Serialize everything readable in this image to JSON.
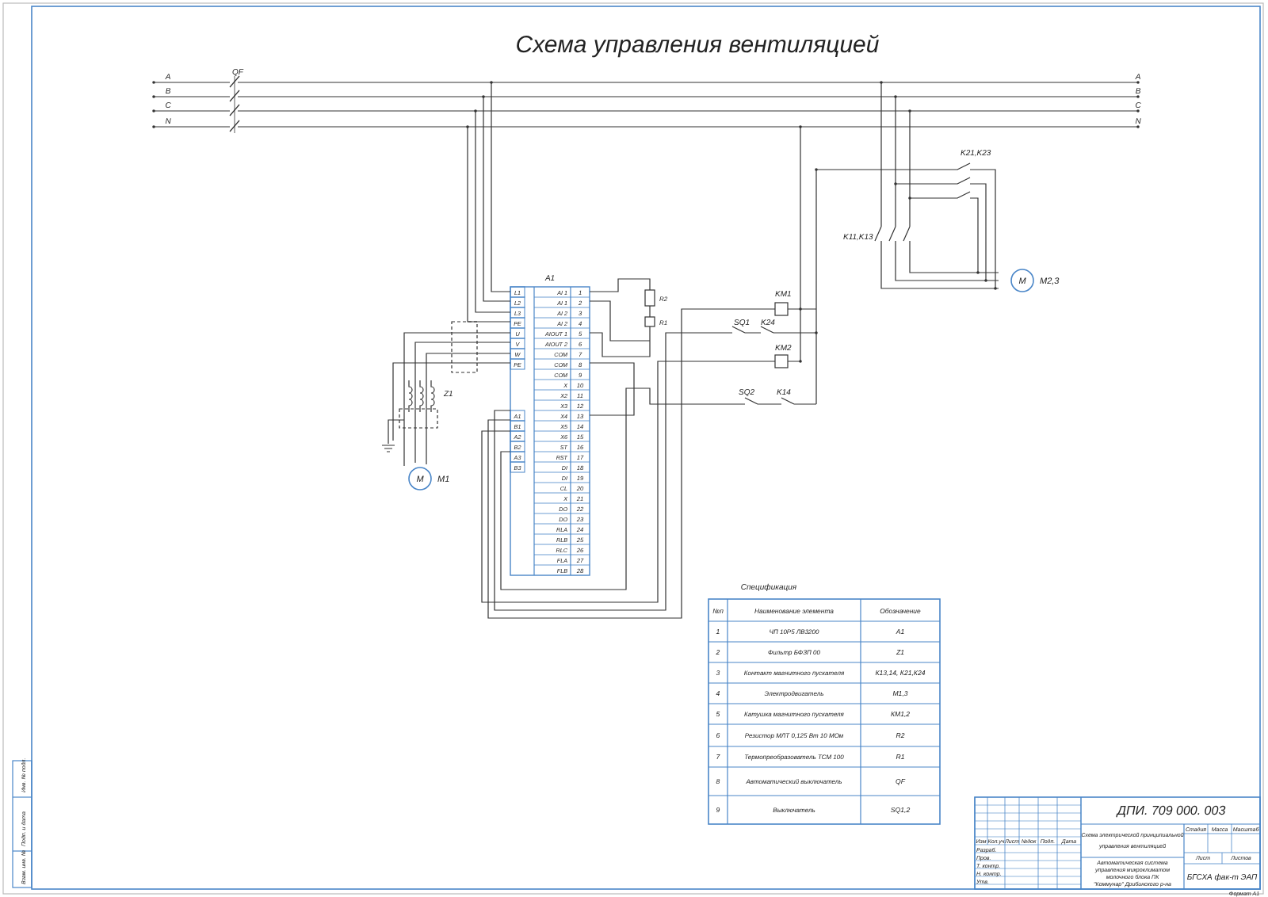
{
  "title": "Схема управления вентиляцией",
  "phase_labels_left": [
    "A",
    "B",
    "C",
    "N"
  ],
  "phase_labels_right": [
    "A",
    "B",
    "C",
    "N"
  ],
  "breaker": {
    "label": "QF"
  },
  "controller": {
    "label": "A1",
    "left_terminals": [
      "L1",
      "L2",
      "L3",
      "PE",
      "U",
      "V",
      "W",
      "PE",
      "A1",
      "B1",
      "A2",
      "B2",
      "A3",
      "B3"
    ],
    "signals": [
      "AI 1",
      "AI 1",
      "AI 2",
      "AI 2",
      "AIOUT 1",
      "AIOUT 2",
      "COM",
      "COM",
      "COM",
      "X",
      "X2",
      "X3",
      "X4",
      "X5",
      "X6",
      "ST",
      "RST",
      "DI",
      "DI",
      "CL",
      "X",
      "DO",
      "DO",
      "RLA",
      "RLB",
      "RLC",
      "FLA",
      "FLB"
    ],
    "numbers": [
      "1",
      "2",
      "3",
      "4",
      "5",
      "6",
      "7",
      "8",
      "9",
      "10",
      "11",
      "12",
      "13",
      "14",
      "15",
      "16",
      "17",
      "18",
      "19",
      "20",
      "21",
      "22",
      "23",
      "24",
      "25",
      "26",
      "27",
      "28"
    ]
  },
  "filter": {
    "label": "Z1"
  },
  "motors": [
    {
      "letter": "M",
      "label": "M1"
    },
    {
      "letter": "M",
      "label": "M2,3"
    }
  ],
  "resistors": [
    {
      "label": "R2"
    },
    {
      "label": "R1"
    }
  ],
  "coils": [
    {
      "label": "KM1"
    },
    {
      "label": "KM2"
    }
  ],
  "contacts": [
    {
      "label": "K21,K23"
    },
    {
      "label": "K11,K13"
    },
    {
      "label": "SQ1"
    },
    {
      "label": "K24"
    },
    {
      "label": "SQ2"
    },
    {
      "label": "K14"
    }
  ],
  "specification": {
    "title": "Спецификация",
    "columns": [
      "№п",
      "Наименование элемента",
      "Обозначение"
    ],
    "rows": [
      [
        "1",
        "ЧП 10Р5 ЛВ3200",
        "A1"
      ],
      [
        "2",
        "Фильтр БФЗП 00",
        "Z1"
      ],
      [
        "3",
        "Контакт магнитного пускателя",
        "К13,14, К21,К24"
      ],
      [
        "4",
        "Электродвигатель",
        "М1,3"
      ],
      [
        "5",
        "Катушка магнитного пускателя",
        "КМ1,2"
      ],
      [
        "6",
        "Резистор МЛТ 0,125 Вт  10 МОм",
        "R2"
      ],
      [
        "7",
        "Термопреобразователь ТСМ 100",
        "R1"
      ],
      [
        "8",
        "Автоматический выключатель",
        "QF"
      ],
      [
        "9",
        "Выключатель",
        "SQ1,2"
      ]
    ]
  },
  "title_block": {
    "designation": "ДПИ. 709 000. 003",
    "name_lines": [
      "Схема электрической принципиальной",
      "управления вентиляцией"
    ],
    "project_lines": [
      "Автоматическая система",
      "управления микроклиматом",
      "молочного блока ПК",
      "\"Коммунар\" Дрибинского р-на"
    ],
    "stage_headers": [
      "Стадия",
      "Масса",
      "Масштаб"
    ],
    "sheet_headers": [
      "Лист",
      "Листов"
    ],
    "organization": "БГСХА фак-т ЭАП",
    "change_headers": [
      "Изм",
      "Кол.уч",
      "Лист",
      "№док",
      "Подп.",
      "Дата"
    ],
    "roles": [
      "Разраб.",
      "Пров.",
      "Т. контр.",
      "Н. контр.",
      "Утв."
    ],
    "format": "Формат   А1"
  },
  "side_stamp": [
    "Инв. № подл.",
    "Подп. и дата",
    "Взам. инв. №"
  ]
}
